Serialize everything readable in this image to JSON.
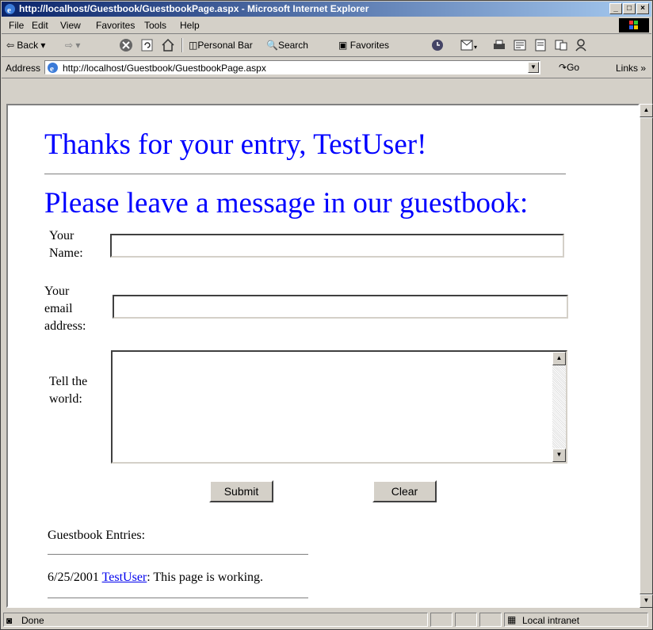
{
  "window": {
    "title": "http://localhost/Guestbook/GuestbookPage.aspx - Microsoft Internet Explorer",
    "caption_buttons": [
      "_",
      "□",
      "×"
    ]
  },
  "menu": [
    "File",
    "Edit",
    "View",
    "Favorites",
    "Tools",
    "Help"
  ],
  "toolbar": {
    "back": "Back",
    "personal_bar": "Personal Bar",
    "search": "Search",
    "favorites": "Favorites"
  },
  "address": {
    "label": "Address",
    "url": "http://localhost/Guestbook/GuestbookPage.aspx",
    "go": "Go",
    "links": "Links »"
  },
  "page": {
    "thanks_heading": "Thanks for your entry, TestUser!",
    "prompt_heading": "Please leave a message in our guestbook:",
    "name_label_1": "Your",
    "name_label_2": "Name:",
    "email_label_1": "Your",
    "email_label_2": "email",
    "email_label_3": "address:",
    "message_label_1": "Tell the",
    "message_label_2": "world:",
    "submit": "Submit",
    "clear": "Clear",
    "entries_label": "Guestbook Entries:",
    "entries": [
      {
        "date": "6/25/2001",
        "user": "TestUser",
        "message": ": This page is working."
      }
    ]
  },
  "status": {
    "text": "Done",
    "zone": "Local intranet"
  },
  "colors": {
    "heading": "#0000ff",
    "link": "#0000ee",
    "titlebar_start": "#0a246a"
  }
}
